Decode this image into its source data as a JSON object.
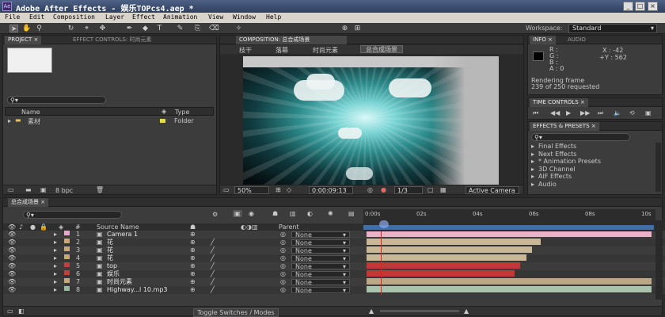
{
  "window": {
    "title": "Adobe After Effects - 娱乐TOPcs4.aep *",
    "buttons": [
      "_",
      "□",
      "×"
    ]
  },
  "menu": [
    "File",
    "Edit",
    "Composition",
    "Layer",
    "Effect",
    "Animation",
    "View",
    "Window",
    "Help"
  ],
  "toolbar": {
    "workspace_label": "Workspace:",
    "workspace_value": "Standard",
    "tools": [
      "arrow",
      "hand",
      "zoom",
      "rotate",
      "camera",
      "orbit",
      "pen",
      "text",
      "brush",
      "clone",
      "eraser",
      "puppet"
    ]
  },
  "project": {
    "tabs": [
      "PROJECT ×",
      "EFFECT CONTROLS: 时尚元素"
    ],
    "col_name": "Name",
    "col_type": "Type",
    "items": [
      {
        "name": "素材",
        "type": "Folder"
      }
    ],
    "bpc": "8 bpc"
  },
  "composition": {
    "tab": "COMPOSITION: 总合成场景",
    "breadcrumbs": [
      "枝干",
      "落幕",
      "时尚元素",
      "总合成场景"
    ],
    "zoom": "50%",
    "timecode": "0:00:09:13",
    "resolution": "1/3",
    "camera": "Active Camera"
  },
  "info": {
    "tabs": [
      "INFO ×",
      "AUDIO"
    ],
    "r": "R :",
    "g": "G :",
    "b": "B :",
    "a": "A : 0",
    "x": "X : -42",
    "y": "Y : 562",
    "status1": "Rendering frame",
    "status2": "239 of 250 requested"
  },
  "time_controls": {
    "tab": "TIME CONTROLS ×"
  },
  "effects": {
    "tab": "EFFECTS & PRESETS ×",
    "items": [
      "Final Effects",
      "Next Effects",
      "* Animation Presets",
      "3D Channel",
      "AIF Effects",
      "Audio"
    ]
  },
  "timeline": {
    "tab": "总合成场景 ×",
    "timecode": "0:00:09:13",
    "col_num": "#",
    "col_source": "Source Name",
    "col_parent": "Parent",
    "ruler_labels": [
      "0:00s",
      "02s",
      "04s",
      "06s",
      "08s",
      "10s"
    ],
    "layers": [
      {
        "num": "1",
        "name": "Camera 1",
        "parent": "None",
        "label_color": "#e8a8c8",
        "bar_color": "#e8b4c8",
        "bar_start": 0,
        "bar_end": 10
      },
      {
        "num": "2",
        "name": "花",
        "parent": "None",
        "label_color": "#c8a878",
        "bar_color": "#c8b898",
        "bar_start": 0,
        "bar_end": 6.1
      },
      {
        "num": "3",
        "name": "花",
        "parent": "None",
        "label_color": "#c8a878",
        "bar_color": "#c8b898",
        "bar_start": 0,
        "bar_end": 5.8
      },
      {
        "num": "4",
        "name": "花",
        "parent": "None",
        "label_color": "#c8a878",
        "bar_color": "#c8b898",
        "bar_start": 0,
        "bar_end": 5.6
      },
      {
        "num": "5",
        "name": "top",
        "parent": "None",
        "label_color": "#c04040",
        "bar_color": "#c03838",
        "bar_start": 0,
        "bar_end": 5.4
      },
      {
        "num": "6",
        "name": "娱乐",
        "parent": "None",
        "label_color": "#c04040",
        "bar_color": "#c03838",
        "bar_start": 0,
        "bar_end": 5.2
      },
      {
        "num": "7",
        "name": "时尚元素",
        "parent": "None",
        "label_color": "#c8a878",
        "bar_color": "#bca886",
        "bar_start": 0,
        "bar_end": 10
      },
      {
        "num": "8",
        "name": "Highway...l 10.mp3",
        "parent": "None",
        "label_color": "#98b8a0",
        "bar_color": "#a8c4ac",
        "bar_start": 0,
        "bar_end": 10
      }
    ],
    "toggle_label": "Toggle Switches / Modes"
  }
}
